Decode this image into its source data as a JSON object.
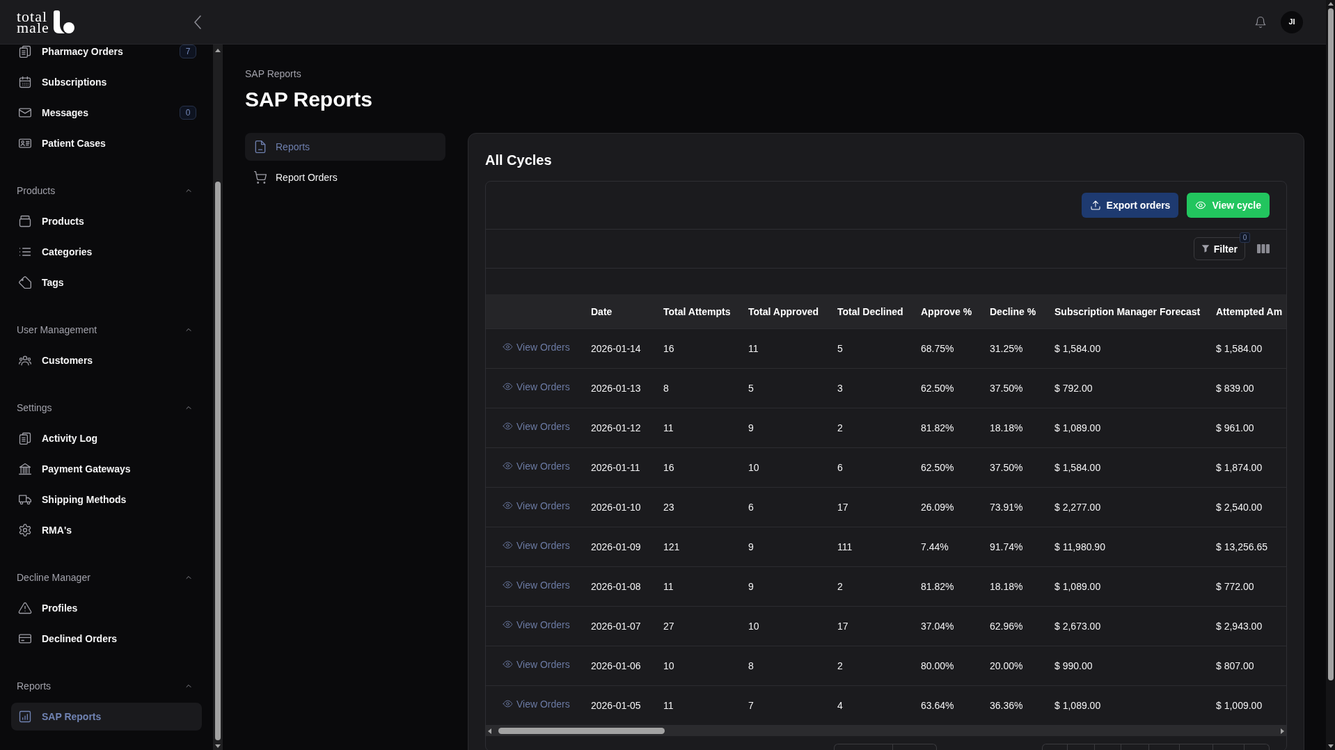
{
  "topbar": {
    "logo": {
      "lines": [
        "total",
        "male"
      ]
    },
    "avatar": {
      "initials": "JI"
    }
  },
  "sidebar": {
    "sections": [
      {
        "items": [
          {
            "label": "Pharmacy Orders",
            "badge": "7",
            "selected": false
          },
          {
            "label": "Subscriptions",
            "selected": false
          },
          {
            "label": "Messages",
            "badge": "0",
            "selected": false
          },
          {
            "label": "Patient Cases",
            "selected": false
          }
        ]
      },
      {
        "title": "Products",
        "expanded": true,
        "items": [
          {
            "label": "Products",
            "selected": false
          },
          {
            "label": "Categories",
            "selected": false
          },
          {
            "label": "Tags",
            "selected": false
          }
        ]
      },
      {
        "title": "User Management",
        "expanded": true,
        "items": [
          {
            "label": "Customers",
            "selected": false
          }
        ]
      },
      {
        "title": "Settings",
        "expanded": true,
        "items": [
          {
            "label": "Activity Log",
            "selected": false
          },
          {
            "label": "Payment Gateways",
            "selected": false
          },
          {
            "label": "Shipping Methods",
            "selected": false
          },
          {
            "label": "RMA's",
            "selected": false
          }
        ]
      },
      {
        "title": "Decline Manager",
        "expanded": true,
        "items": [
          {
            "label": "Profiles",
            "selected": false
          },
          {
            "label": "Declined Orders",
            "selected": false
          }
        ]
      },
      {
        "title": "Reports",
        "expanded": true,
        "items": [
          {
            "label": "SAP Reports",
            "selected": true
          }
        ]
      }
    ]
  },
  "page": {
    "breadcrumb": "SAP Reports",
    "title": "SAP Reports"
  },
  "subnav": [
    {
      "label": "Reports",
      "selected": true
    },
    {
      "label": "Report Orders",
      "selected": false
    }
  ],
  "card": {
    "title": "All Cycles",
    "actions": [
      {
        "kind": "export",
        "label": "Export orders"
      },
      {
        "kind": "view",
        "label": "View cycle"
      }
    ],
    "filter": {
      "label": "Filter",
      "count": "0"
    },
    "table": {
      "columns": [
        "Date",
        "Total Attempts",
        "Total Approved",
        "Total Declined",
        "Approve %",
        "Decline %",
        "Subscription Manager Forecast",
        "Attempted Am"
      ],
      "rows": [
        {
          "action": "View Orders",
          "cells": [
            "2026-01-14",
            "16",
            "11",
            "5",
            "68.75%",
            "31.25%",
            "$ 1,584.00",
            "$ 1,584.00"
          ]
        },
        {
          "action": "View Orders",
          "cells": [
            "2026-01-13",
            "8",
            "5",
            "3",
            "62.50%",
            "37.50%",
            "$ 792.00",
            "$ 839.00"
          ]
        },
        {
          "action": "View Orders",
          "cells": [
            "2026-01-12",
            "11",
            "9",
            "2",
            "81.82%",
            "18.18%",
            "$ 1,089.00",
            "$ 961.00"
          ]
        },
        {
          "action": "View Orders",
          "cells": [
            "2026-01-11",
            "16",
            "10",
            "6",
            "62.50%",
            "37.50%",
            "$ 1,584.00",
            "$ 1,874.00"
          ]
        },
        {
          "action": "View Orders",
          "cells": [
            "2026-01-10",
            "23",
            "6",
            "17",
            "26.09%",
            "73.91%",
            "$ 2,277.00",
            "$ 2,540.00"
          ]
        },
        {
          "action": "View Orders",
          "cells": [
            "2026-01-09",
            "121",
            "9",
            "111",
            "7.44%",
            "91.74%",
            "$ 11,980.90",
            "$ 13,256.65"
          ]
        },
        {
          "action": "View Orders",
          "cells": [
            "2026-01-08",
            "11",
            "9",
            "2",
            "81.82%",
            "18.18%",
            "$ 1,089.00",
            "$ 772.00"
          ]
        },
        {
          "action": "View Orders",
          "cells": [
            "2026-01-07",
            "27",
            "10",
            "17",
            "37.04%",
            "62.96%",
            "$ 2,673.00",
            "$ 2,943.00"
          ]
        },
        {
          "action": "View Orders",
          "cells": [
            "2026-01-06",
            "10",
            "8",
            "2",
            "80.00%",
            "20.00%",
            "$ 990.00",
            "$ 807.00"
          ]
        },
        {
          "action": "View Orders",
          "cells": [
            "2026-01-05",
            "11",
            "7",
            "4",
            "63.64%",
            "36.36%",
            "$ 1,089.00",
            "$ 1,009.00"
          ]
        }
      ]
    }
  }
}
